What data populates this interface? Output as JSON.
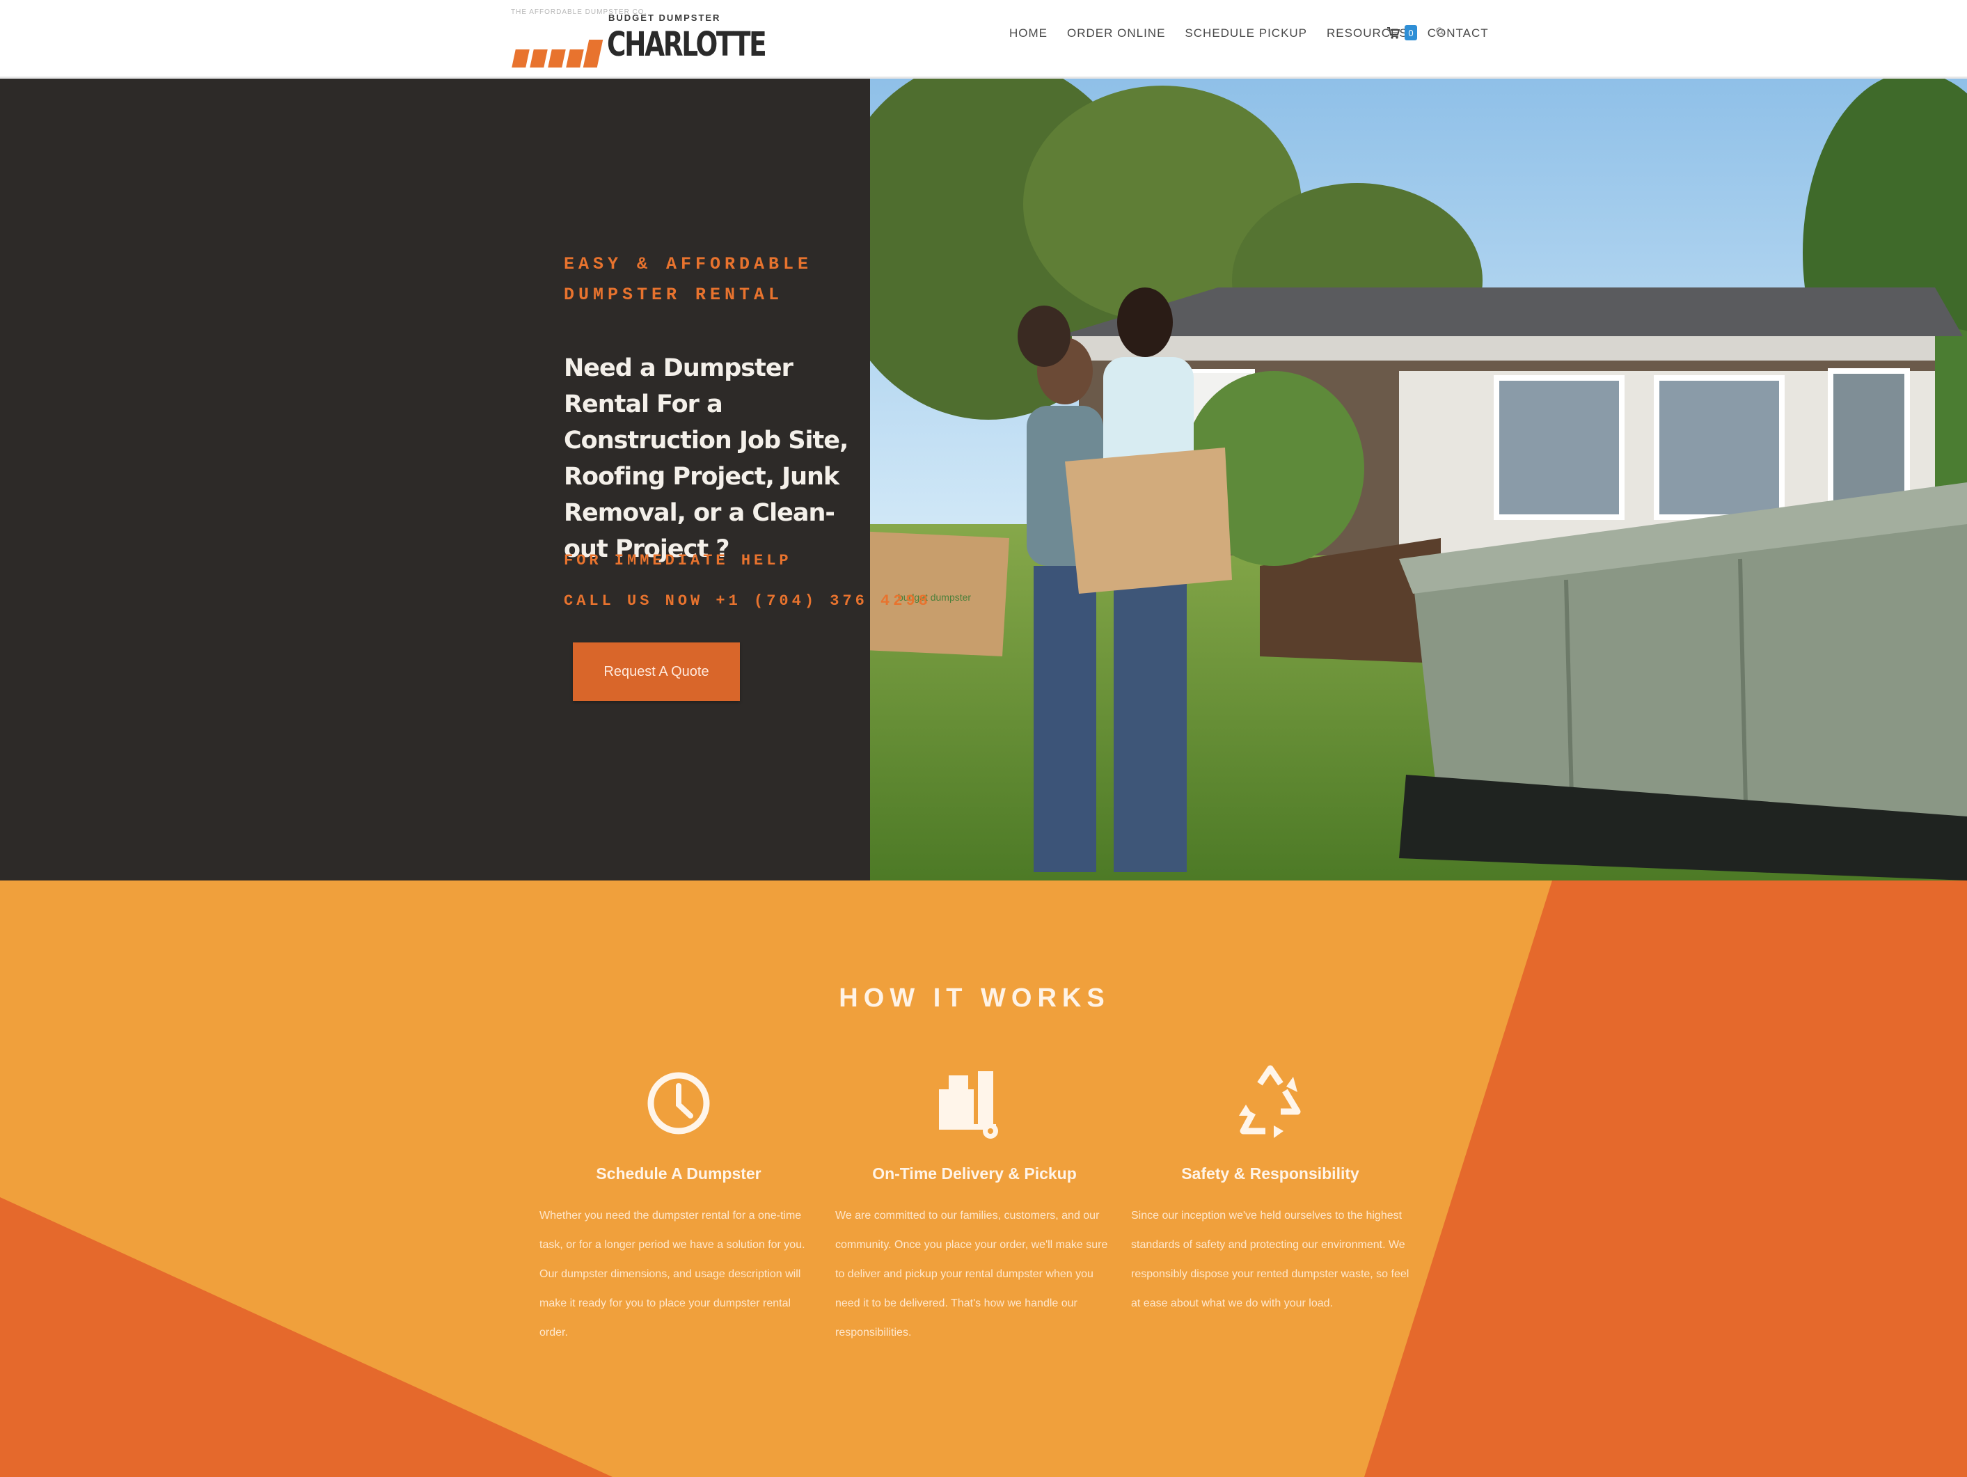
{
  "header": {
    "logo": {
      "tagline": "THE AFFORDABLE DUMPSTER CO.",
      "brand": "BUDGET DUMPSTER",
      "city": "CHARLOTTE"
    },
    "nav": [
      "HOME",
      "ORDER ONLINE",
      "SCHEDULE PICKUP",
      "RESOURCES",
      "CONTACT"
    ],
    "cart_count": "0"
  },
  "hero": {
    "eyebrow": "EASY & AFFORDABLE\nDUMPSTER RENTAL",
    "headline": "Need a Dumpster Rental For a Construction Job Site, Roofing Project, Junk Removal, or a Clean-out Project ?",
    "help_line": "FOR IMMEDIATE HELP",
    "call_line": "CALL US NOW +1 (704) 376 4298",
    "button": "Request A Quote",
    "box_label": "budget dumpster"
  },
  "how_it_works": {
    "title": "HOW IT WORKS",
    "steps": [
      {
        "icon": "clock-icon",
        "title": "Schedule A Dumpster",
        "body": "Whether you need the dumpster rental for a one-time task, or for a longer period we have a solution for you. Our dumpster dimensions, and usage description will make it ready for you to place your dumpster rental order."
      },
      {
        "icon": "truck-delivery-icon",
        "title": "On-Time Delivery & Pickup",
        "body": "We are committed to our families, customers, and our community. Once you place your order, we'll make sure to deliver and pickup your rental dumpster when you need it to be delivered. That's how we handle our responsibilities."
      },
      {
        "icon": "recycle-icon",
        "title": "Safety & Responsibility",
        "body": "Since our inception we've held ourselves to the highest standards of safety and protecting our environment. We responsibly dispose your rented dumpster waste, so feel at ease about what we do with your load."
      }
    ]
  },
  "colors": {
    "accent": "#e8732e",
    "dark_panel": "#2d2a28",
    "orange_light": "#f0a03c",
    "orange_dark": "#e5692c"
  }
}
